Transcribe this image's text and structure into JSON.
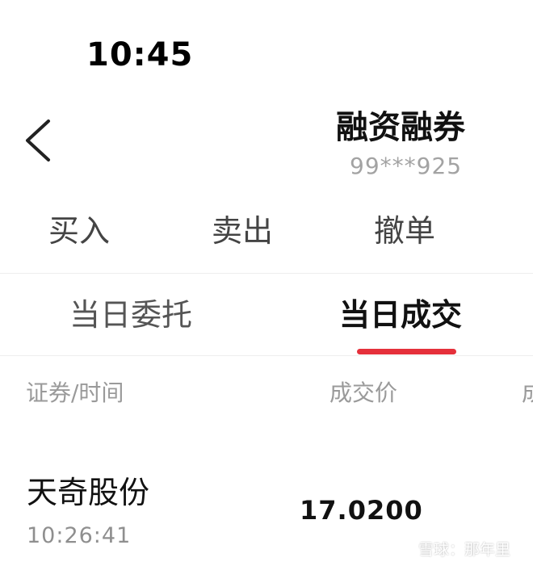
{
  "status_bar": {
    "time": "10:45"
  },
  "header": {
    "back_icon": "chevron-left-icon",
    "title": "融资融券",
    "account": "99***925"
  },
  "action_tabs": [
    {
      "label": "买入"
    },
    {
      "label": "卖出"
    },
    {
      "label": "撤单"
    }
  ],
  "sub_tabs": [
    {
      "label": "当日委托",
      "active": false
    },
    {
      "label": "当日成交",
      "active": true
    }
  ],
  "colors": {
    "accent": "#e5303b",
    "muted_text": "#9a9a9a"
  },
  "table": {
    "columns": [
      "证券/时间",
      "成交价",
      "成"
    ],
    "rows": [
      {
        "name": "天奇股份",
        "time": "10:26:41",
        "price": "17.0200"
      }
    ]
  },
  "watermark": {
    "logo_icon": "snowball-logo-icon",
    "text": "雪球：那年里"
  }
}
